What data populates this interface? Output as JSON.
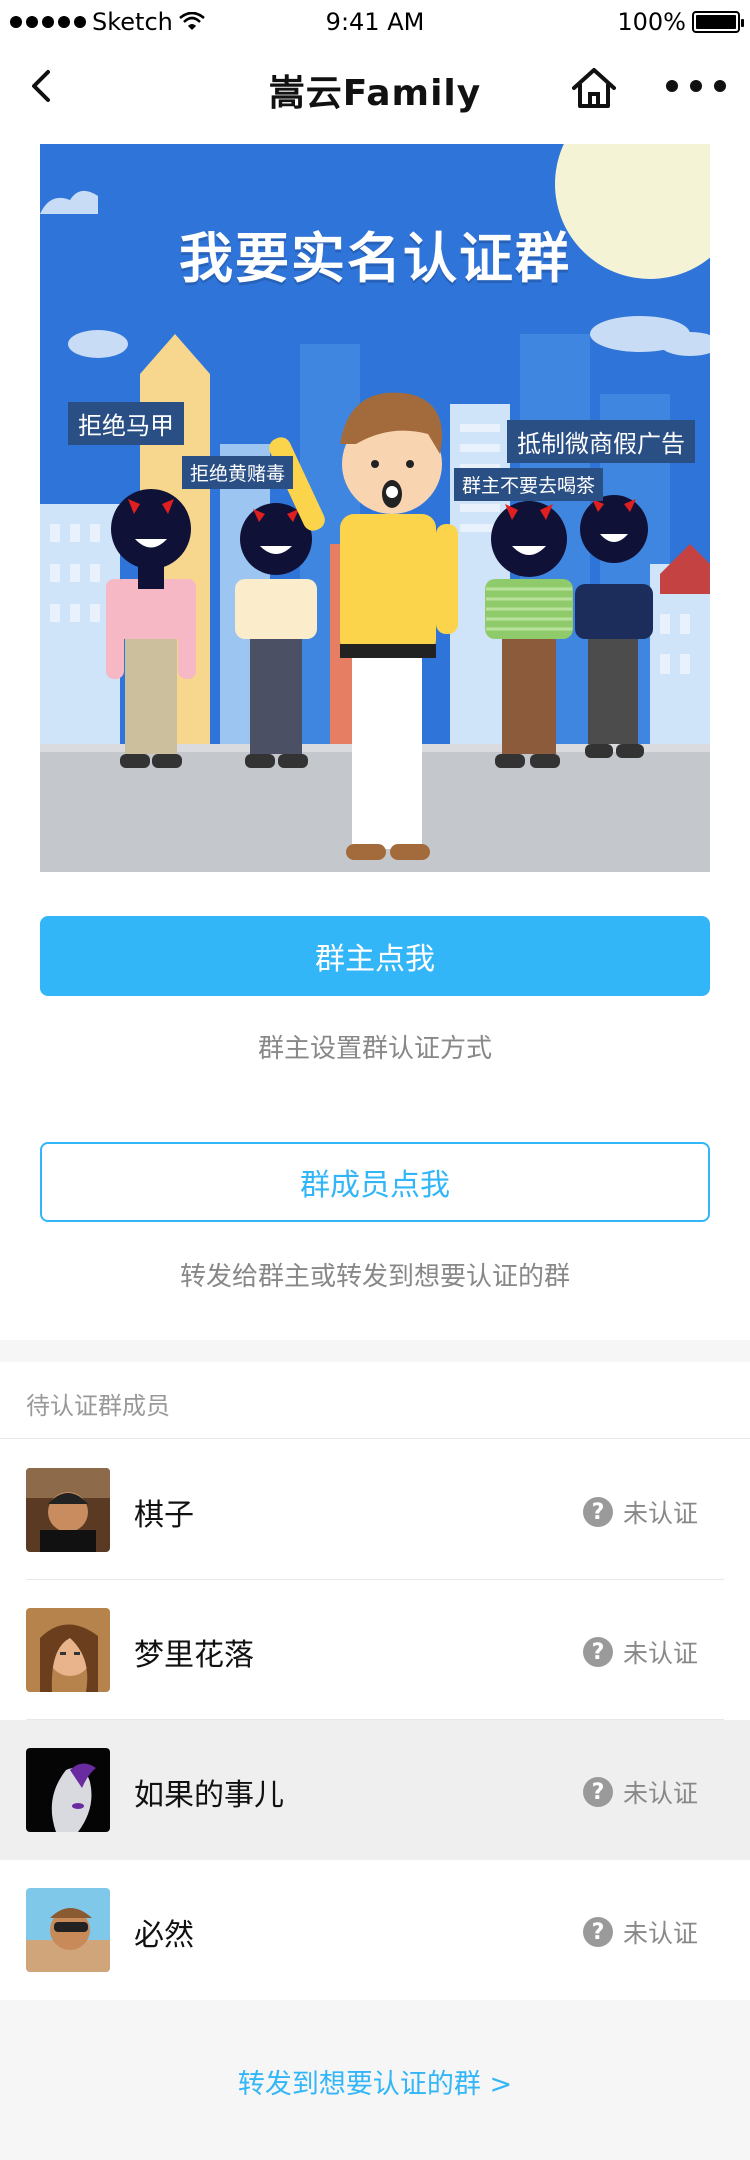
{
  "status_bar": {
    "carrier": "Sketch",
    "time": "9:41 AM",
    "battery": "100%"
  },
  "nav": {
    "title": "嵩云Family",
    "icons": [
      "back-icon",
      "home-icon",
      "more-icon"
    ]
  },
  "banner": {
    "title": "我要实名认证群",
    "bubbles": [
      "拒绝马甲",
      "拒绝黄赌毒",
      "抵制微商假广告",
      "群主不要去喝茶"
    ]
  },
  "owner_section": {
    "button_label": "群主点我",
    "hint": "群主设置群认证方式"
  },
  "member_section": {
    "button_label": "群成员点我",
    "hint": "转发给群主或转发到想要认证的群"
  },
  "pending": {
    "title": "待认证群成员",
    "members": [
      {
        "name": "棋子",
        "status": "未认证"
      },
      {
        "name": "梦里花落",
        "status": "未认证"
      },
      {
        "name": "如果的事儿",
        "status": "未认证"
      },
      {
        "name": "必然",
        "status": "未认证"
      }
    ]
  },
  "footer": {
    "link": "转发到想要认证的群 >"
  },
  "colors": {
    "accent": "#33b6f7",
    "banner_bg": "#2f74d9"
  }
}
